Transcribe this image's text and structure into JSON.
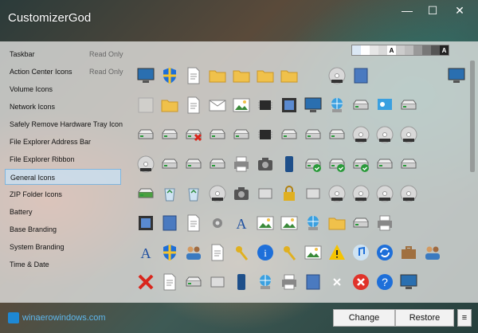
{
  "window": {
    "title": "CustomizerGod"
  },
  "sidebar": {
    "items": [
      {
        "label": "Taskbar",
        "status": "Read Only"
      },
      {
        "label": "Action Center Icons",
        "status": "Read Only"
      },
      {
        "label": "Volume Icons",
        "status": ""
      },
      {
        "label": "Network Icons",
        "status": ""
      },
      {
        "label": "Safely Remove Hardware Tray Icon",
        "status": ""
      },
      {
        "label": "File Explorer Address Bar",
        "status": ""
      },
      {
        "label": "File Explorer Ribbon",
        "status": ""
      },
      {
        "label": "General Icons",
        "status": ""
      },
      {
        "label": "ZIP Folder Icons",
        "status": ""
      },
      {
        "label": "Battery",
        "status": ""
      },
      {
        "label": "Base Branding",
        "status": ""
      },
      {
        "label": "System Branding",
        "status": ""
      },
      {
        "label": "Time & Date",
        "status": ""
      }
    ],
    "selected": "General Icons"
  },
  "swatches": [
    {
      "color": "#dbe8f5",
      "text": ""
    },
    {
      "color": "#ffffff",
      "text": ""
    },
    {
      "color": "#e6e6e6",
      "text": ""
    },
    {
      "color": "#d9d9d9",
      "text": ""
    },
    {
      "color": "#ffffff",
      "text": "A"
    },
    {
      "color": "#cccccc",
      "text": ""
    },
    {
      "color": "#bdbdbd",
      "text": ""
    },
    {
      "color": "#999999",
      "text": ""
    },
    {
      "color": "#777777",
      "text": ""
    },
    {
      "color": "#555555",
      "text": ""
    },
    {
      "color": "#222222",
      "text": "A"
    }
  ],
  "icons": [
    "monitor-icon",
    "shield-icon",
    "document-icon",
    "folder-icon",
    "folder-icon",
    "folder-icon",
    "folder-narrow-icon",
    "",
    "cd-icon",
    "blue-card-icon",
    "",
    "",
    "",
    "window-icon",
    "blank-icon",
    "folder-search-icon",
    "list-document-icon",
    "envelope-icon",
    "picture-icon",
    "circuit-icon",
    "film-icon",
    "monitor-check-icon",
    "network-icon",
    "drive-icon",
    "control-panel-icon",
    "drive-icon",
    "",
    "",
    "drive-icon",
    "disc-drive-icon",
    "drive-x-icon",
    "drive-icon",
    "drive-icon",
    "chip-icon",
    "drive-icon",
    "drive-icon",
    "disc-drive-icon",
    "dvd-icon",
    "dvd-ram-icon",
    "dvd-rom-icon",
    "",
    "",
    "dvd-rw-icon",
    "drive-icon",
    "drive-icon",
    "drive-icon",
    "printer-icon",
    "camera-icon",
    "phone-icon",
    "drive-check-icon",
    "drive-check-icon",
    "drive-check-icon",
    "drive-icon",
    "drive-icon",
    "",
    "",
    "drive-green-icon",
    "recycle-full-icon",
    "recycle-empty-icon",
    "dvd-icon",
    "photo-camera-icon",
    "plug-icon",
    "lock-icon",
    "sd-card-icon",
    "cd-icon",
    "cd-r-icon",
    "cd-rom-icon",
    "cd-rw-icon",
    "",
    "",
    "film-reel-icon",
    "books-icon",
    "document-gear-icon",
    "gear-icon",
    "font-icon",
    "picture-icon",
    "landscape-icon",
    "globe-icon",
    "network-folder-icon",
    "help-drive-icon",
    "printer-icon",
    "",
    "",
    "",
    "font-a-icon",
    "shield-icon",
    "users-icon",
    "checklist-icon",
    "keyboard-icon",
    "info-icon",
    "key-icon",
    "picture-frame-icon",
    "warning-icon",
    "music-icon",
    "sync-icon",
    "briefcase-icon",
    "users-icon",
    "",
    "close-red-icon",
    "document-icon",
    "drive-icon",
    "cylinder-icon",
    "tablet-icon",
    "network-computer-icon",
    "scanner-icon",
    "blue-box-icon",
    "x-small-icon",
    "error-icon",
    "help-icon",
    "monitor-blue-icon",
    "",
    ""
  ],
  "bottom": {
    "brand": "winaero",
    "brand_suffix": "windows.com",
    "change_label": "Change",
    "restore_label": "Restore",
    "menu_label": "≡"
  }
}
